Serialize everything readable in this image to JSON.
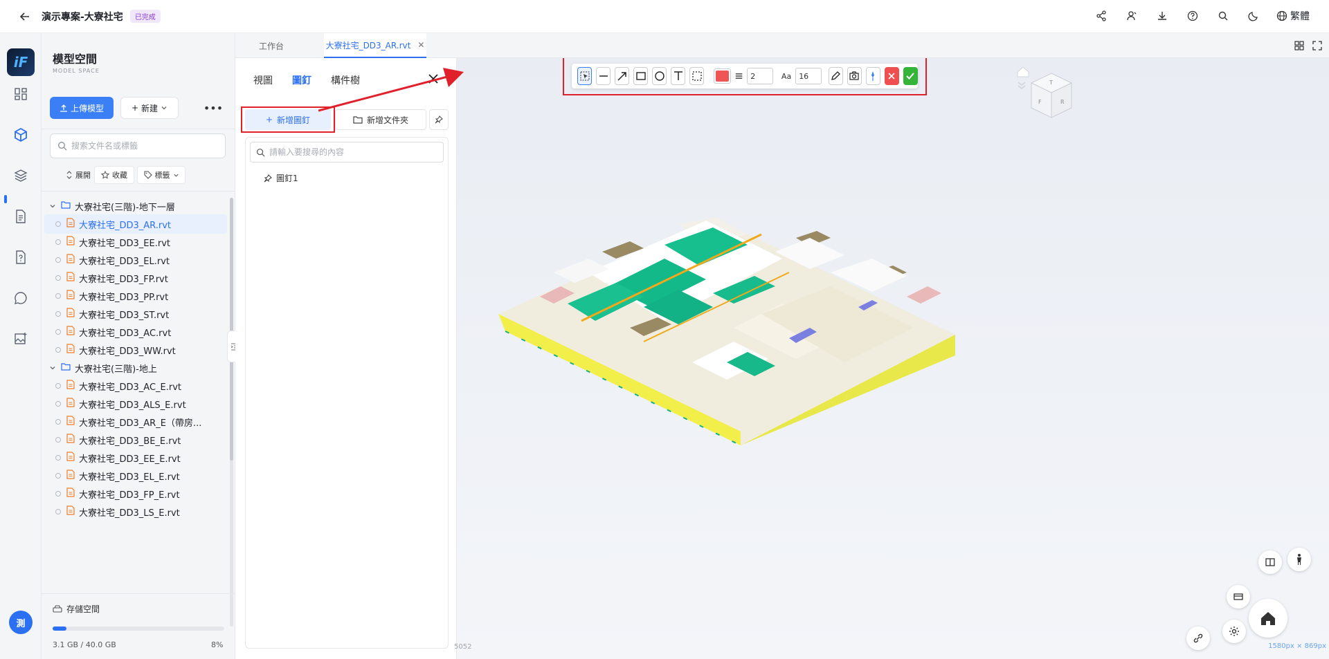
{
  "header": {
    "title": "演示專案-大寮社宅",
    "status": "已完成",
    "language": "繁體"
  },
  "rail": {
    "logo": "iF",
    "avatar": "測"
  },
  "sidebar": {
    "title": "模型空間",
    "subtitle": "MODEL SPACE",
    "upload_label": "上傳模型",
    "new_label": "新建",
    "search_placeholder": "搜索文件名或標籤",
    "filters": [
      "展開",
      "收藏",
      "標籤"
    ],
    "folders": [
      {
        "name": "大寮社宅(三階)-地下一層",
        "files": [
          "大寮社宅_DD3_AR.rvt",
          "大寮社宅_DD3_EE.rvt",
          "大寮社宅_DD3_EL.rvt",
          "大寮社宅_DD3_FP.rvt",
          "大寮社宅_DD3_PP.rvt",
          "大寮社宅_DD3_ST.rvt",
          "大寮社宅_DD3_AC.rvt",
          "大寮社宅_DD3_WW.rvt"
        ]
      },
      {
        "name": "大寮社宅(三階)-地上",
        "files": [
          "大寮社宅_DD3_AC_E.rvt",
          "大寮社宅_DD3_ALS_E.rvt",
          "大寮社宅_DD3_AR_E（帶房...",
          "大寮社宅_DD3_BE_E.rvt",
          "大寮社宅_DD3_EE_E.rvt",
          "大寮社宅_DD3_EL_E.rvt",
          "大寮社宅_DD3_FP_E.rvt",
          "大寮社宅_DD3_LS_E.rvt"
        ]
      }
    ],
    "storage": {
      "label": "存儲空間",
      "used": "3.1 GB / 40.0 GB",
      "percent": "8%",
      "fraction": 0.08
    }
  },
  "tabs": [
    {
      "label": "工作台"
    },
    {
      "label": "大寮社宅_DD3_AR.rvt",
      "active": true
    }
  ],
  "panel": {
    "tabs": [
      "視圖",
      "圖釘",
      "構件樹"
    ],
    "active_tab": "圖釘",
    "add_pin": "新增圖釘",
    "add_folder": "新增文件夾",
    "search_placeholder": "請輸入要搜尋的內容",
    "pins": [
      "圖釘1"
    ]
  },
  "toolbar": {
    "line_width": "2",
    "font_label": "Aa",
    "font_size": "16",
    "color": "#f05555"
  },
  "viewer": {
    "status_left": "5052",
    "status_right": "1580px × 869px"
  },
  "colors": {
    "accent": "#2b6ff2",
    "highlight": "#e0202a"
  }
}
